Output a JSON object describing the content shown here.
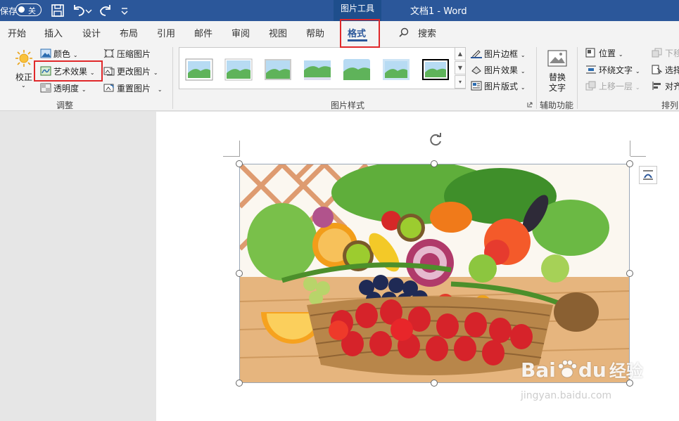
{
  "titlebar": {
    "autosave_label": "保存",
    "toggle_label": "关",
    "context_tab": "图片工具",
    "doc_title": "文档1  -  Word"
  },
  "tabs": [
    {
      "label": "开始"
    },
    {
      "label": "插入"
    },
    {
      "label": "设计"
    },
    {
      "label": "布局"
    },
    {
      "label": "引用"
    },
    {
      "label": "邮件"
    },
    {
      "label": "审阅"
    },
    {
      "label": "视图"
    },
    {
      "label": "帮助"
    },
    {
      "label": "格式"
    }
  ],
  "search": {
    "label": "搜索"
  },
  "ribbon": {
    "adjust": {
      "corrections": "校正",
      "color": "颜色",
      "artistic": "艺术效果",
      "transparency": "透明度",
      "compress": "压缩图片",
      "change": "更改图片",
      "reset": "重置图片",
      "group_label": "调整"
    },
    "styles": {
      "border": "图片边框",
      "effects": "图片效果",
      "layout": "图片版式",
      "group_label": "图片样式"
    },
    "accessibility": {
      "alt_text_line1": "替换",
      "alt_text_line2": "文字",
      "group_label": "辅助功能"
    },
    "arrange": {
      "position": "位置",
      "wrap": "环绕文字",
      "bring_forward": "上移一层",
      "send_backward": "下移",
      "selection": "选择",
      "align": "对齐",
      "group_label": "排列"
    }
  },
  "watermark": {
    "brand": "Bai",
    "brand2": "du",
    "cn": "经验",
    "url": "jingyan.baidu.com"
  },
  "colors": {
    "title_blue": "#2b579a",
    "highlight_red": "#e0282a"
  }
}
